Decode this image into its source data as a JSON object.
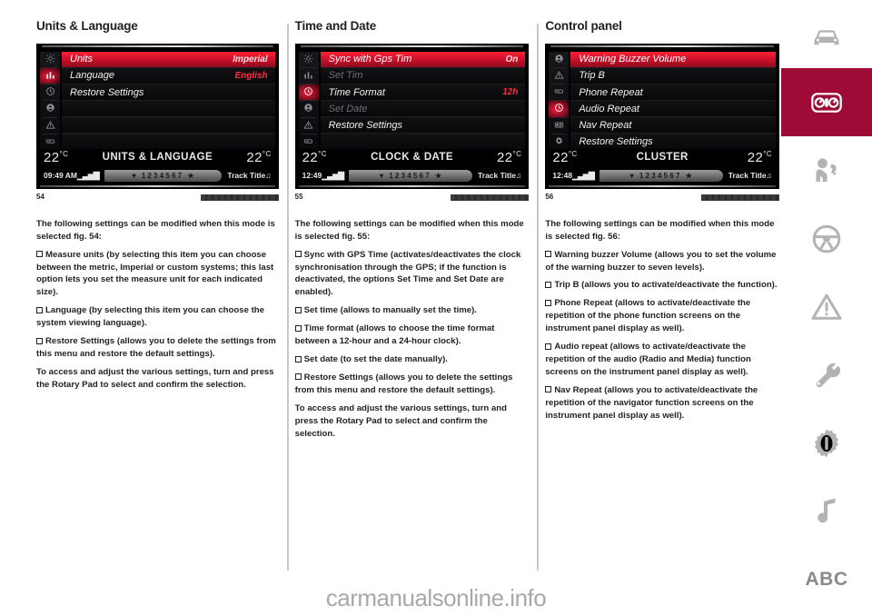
{
  "watermark": "carmanualsonline.info",
  "colors": {
    "accent": "#9e0b37",
    "display_red": "#ff2d3f",
    "text": "#231f20"
  },
  "right_rail": {
    "items": [
      {
        "name": "car-front-icon",
        "label": "Car",
        "active": false
      },
      {
        "name": "instrument-cluster-icon",
        "label": "Cluster",
        "active": true
      },
      {
        "name": "airbag-safety-icon",
        "label": "Safety",
        "active": false
      },
      {
        "name": "steering-wheel-icon",
        "label": "Driving",
        "active": false
      },
      {
        "name": "warning-triangle-icon",
        "label": "Warning lights",
        "active": false
      },
      {
        "name": "wrench-icon",
        "label": "Maintenance",
        "active": false
      },
      {
        "name": "tire-gear-icon",
        "label": "Technical data",
        "active": false
      },
      {
        "name": "music-note-icon",
        "label": "Multimedia",
        "active": false
      },
      {
        "name": "abc-index-icon",
        "label": "ABC",
        "active": false
      }
    ]
  },
  "columns": [
    {
      "title": "Units & Language",
      "display": {
        "side_icons": [
          "brightness-icon",
          "units-icon",
          "clock-icon",
          "safety-icon",
          "warning-icon",
          "screen-icon"
        ],
        "active_side_icon_index": 1,
        "rows": [
          {
            "label": "Units",
            "value": "Imperial",
            "state": "selected"
          },
          {
            "label": "Language",
            "value": "English",
            "state": "normal"
          },
          {
            "label": "Restore Settings",
            "value": "",
            "state": "normal"
          },
          {
            "label": "",
            "value": "",
            "state": "blank"
          },
          {
            "label": "",
            "value": "",
            "state": "blank"
          },
          {
            "label": "",
            "value": "",
            "state": "blank"
          }
        ],
        "temp_left": "22",
        "temp_right": "22",
        "screen_title": "UNITS & LANGUAGE",
        "clock": "09:49 AM",
        "presets": "1 2 3 4 5 6 7",
        "track": "Track Title"
      },
      "figure_number": "54",
      "paragraphs": [
        {
          "bullet": false,
          "text": "The following settings can be modified when this mode is selected fig. 54:"
        },
        {
          "bullet": true,
          "text": "Measure units (by selecting this item you can choose between the metric, Imperial or custom systems; this last option lets you set the measure unit for each indicated size)."
        },
        {
          "bullet": true,
          "text": "Language (by selecting this item you can choose the system viewing language)."
        },
        {
          "bullet": true,
          "text": "Restore Settings (allows you to delete the settings from this menu and restore the default settings)."
        },
        {
          "bullet": false,
          "text": "To access and adjust the various settings, turn and press the Rotary Pad to select and confirm the selection."
        }
      ]
    },
    {
      "title": "Time and Date",
      "display": {
        "side_icons": [
          "brightness-icon",
          "units-icon",
          "clock-icon",
          "safety-icon",
          "warning-icon",
          "screen-icon"
        ],
        "active_side_icon_index": 2,
        "rows": [
          {
            "label": "Sync with Gps Tim",
            "value": "On",
            "state": "selected"
          },
          {
            "label": "Set Tim",
            "value": "",
            "state": "dim"
          },
          {
            "label": "Time Format",
            "value": "12h",
            "state": "normal"
          },
          {
            "label": "Set Date",
            "value": "",
            "state": "dim"
          },
          {
            "label": "Restore Settings",
            "value": "",
            "state": "normal"
          },
          {
            "label": "",
            "value": "",
            "state": "blank"
          }
        ],
        "temp_left": "22",
        "temp_right": "22",
        "screen_title": "CLOCK & DATE",
        "clock": "12:49",
        "presets": "1 2 3 4 5 6 7",
        "track": "Track Title"
      },
      "figure_number": "55",
      "paragraphs": [
        {
          "bullet": false,
          "text": "The following settings can be modified when this mode is selected fig. 55:"
        },
        {
          "bullet": true,
          "text": "Sync with GPS Time (activates/deactivates the clock synchronisation through the GPS; if the function is deactivated, the options Set Time and Set Date are enabled)."
        },
        {
          "bullet": true,
          "text": "Set time (allows to manually set the time)."
        },
        {
          "bullet": true,
          "text": "Time format (allows to choose the time format between a 12-hour and a 24-hour clock)."
        },
        {
          "bullet": true,
          "text": "Set date (to set the date manually)."
        },
        {
          "bullet": true,
          "text": "Restore Settings (allows you to delete the settings from this menu and restore the default settings)."
        },
        {
          "bullet": false,
          "text": "To access and adjust the various settings, turn and press the Rotary Pad to select and confirm the selection."
        }
      ]
    },
    {
      "title": "Control panel",
      "display": {
        "side_icons": [
          "safety-icon",
          "warning-icon",
          "screen-icon",
          "clock-icon",
          "display-icon",
          "gear-icon"
        ],
        "active_side_icon_index": 3,
        "rows": [
          {
            "label": "Warning Buzzer Volume",
            "value": "",
            "state": "selected"
          },
          {
            "label": "Trip B",
            "value": "",
            "state": "normal"
          },
          {
            "label": "Phone Repeat",
            "value": "",
            "state": "normal"
          },
          {
            "label": "Audio Repeat",
            "value": "",
            "state": "normal"
          },
          {
            "label": "Nav Repeat",
            "value": "",
            "state": "normal"
          },
          {
            "label": "Restore Settings",
            "value": "",
            "state": "normal"
          }
        ],
        "temp_left": "22",
        "temp_right": "22",
        "screen_title": "CLUSTER",
        "clock": "12:48",
        "presets": "1 2 3 4 5 6 7",
        "track": "Track Title"
      },
      "figure_number": "56",
      "paragraphs": [
        {
          "bullet": false,
          "text": "The following settings can be modified when this mode is selected fig. 56:"
        },
        {
          "bullet": true,
          "text": "Warning buzzer Volume (allows you to set the volume of the warning buzzer to seven levels)."
        },
        {
          "bullet": true,
          "text": "Trip B (allows you to activate/deactivate the function)."
        },
        {
          "bullet": true,
          "text": "Phone Repeat (allows to activate/deactivate the repetition of the phone function screens on the instrument panel display as well)."
        },
        {
          "bullet": true,
          "text": "Audio repeat (allows to activate/deactivate the repetition of the audio (Radio and Media) function screens on the instrument panel display as well)."
        },
        {
          "bullet": true,
          "text": "Nav Repeat (allows you to activate/deactivate the repetition of the navigator function screens on the instrument panel display as well)."
        }
      ]
    }
  ]
}
